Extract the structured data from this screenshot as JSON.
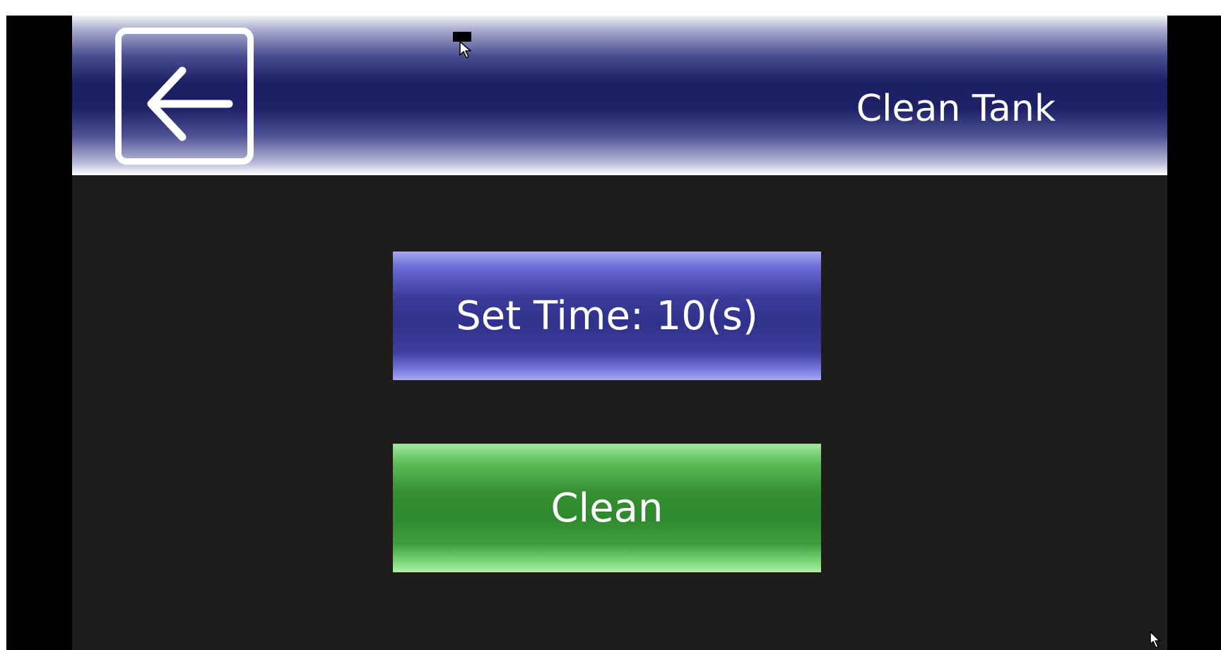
{
  "header": {
    "title": "Clean Tank",
    "back_icon": "arrow-left-icon"
  },
  "controls": {
    "set_time_label": "Set Time: 10(s)",
    "clean_label": "Clean"
  },
  "colors": {
    "header_navy": "#1d1f64",
    "screen_background": "#1e1d1b",
    "set_time_button": "#3b3c9c",
    "clean_button": "#348f33",
    "text": "#ffffff"
  },
  "icons": {
    "top_cursor": "pointer-cursor-icon",
    "corner_cursor": "pointer-cursor-icon"
  }
}
